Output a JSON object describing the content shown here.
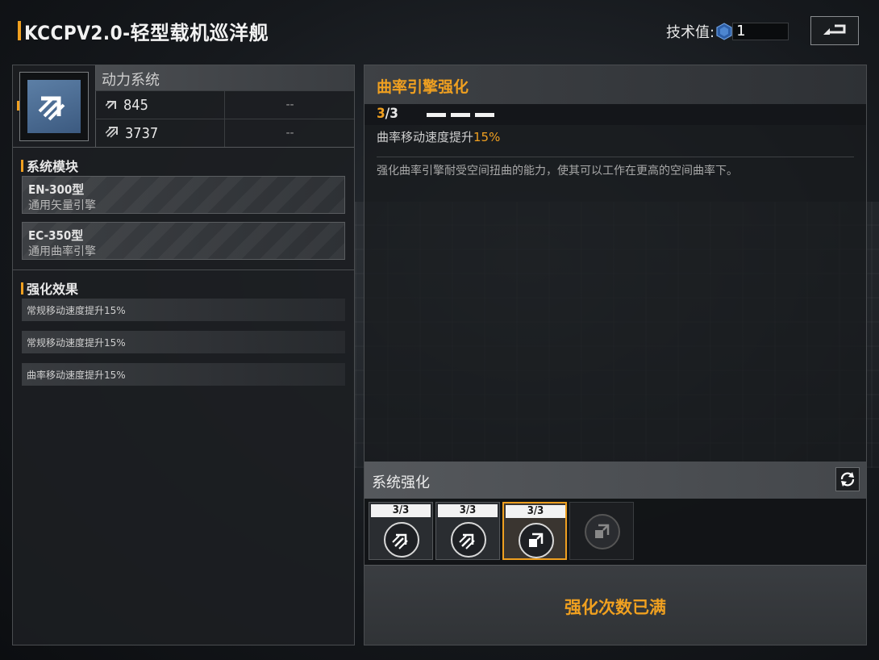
{
  "header": {
    "title": "KCCPV2.0-轻型载机巡洋舰",
    "tech_label": "技术值:",
    "tech_value": "1"
  },
  "system": {
    "name": "动力系统",
    "stats": [
      {
        "icon": "thrust-icon",
        "value": "845",
        "compare": "--"
      },
      {
        "icon": "warp-icon",
        "value": "3737",
        "compare": "--"
      }
    ]
  },
  "modules": {
    "title": "系统模块",
    "items": [
      {
        "name": "EN-300型",
        "type": "通用矢量引擎"
      },
      {
        "name": "EC-350型",
        "type": "通用曲率引擎"
      }
    ]
  },
  "effects": {
    "title": "强化效果",
    "items": [
      "常规移动速度提升15%",
      "常规移动速度提升15%",
      "曲率移动速度提升15%"
    ]
  },
  "detail": {
    "title": "曲率引擎强化",
    "level_current": "3",
    "level_max": "/3",
    "level_fill": 1.0,
    "effect_prefix": "曲率移动速度提升",
    "effect_value": "15%",
    "description": "强化曲率引擎耐受空间扭曲的能力，使其可以工作在更高的空间曲率下。"
  },
  "enhance": {
    "title": "系统强化",
    "slots": [
      {
        "level": "3/3",
        "icon": "thrust-upgrade-icon",
        "selected": false
      },
      {
        "level": "3/3",
        "icon": "thrust-upgrade-icon",
        "selected": false
      },
      {
        "level": "3/3",
        "icon": "warp-upgrade-icon",
        "selected": true
      },
      {
        "level": "",
        "icon": "warp-upgrade-icon",
        "selected": false
      }
    ],
    "status": "强化次数已满"
  },
  "colors": {
    "accent": "#f0a020",
    "panel": "#1c1f22",
    "icon_blue": "#4a6b92"
  }
}
